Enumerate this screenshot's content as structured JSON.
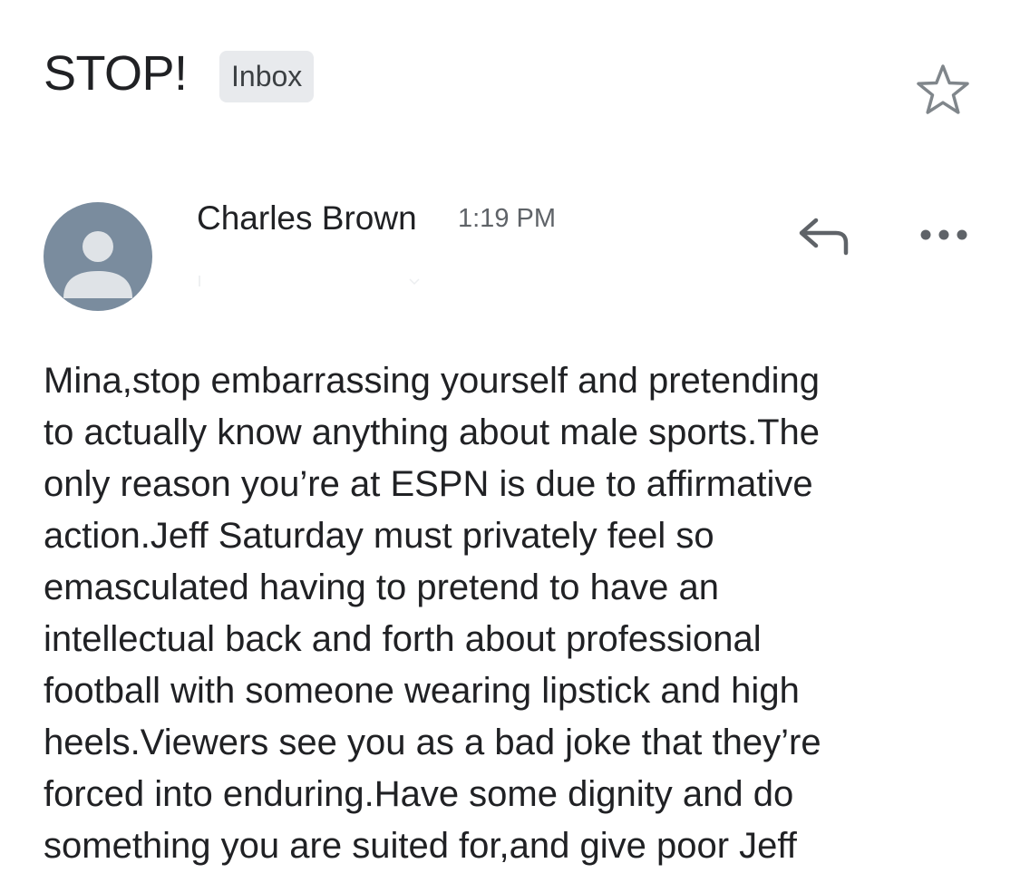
{
  "email": {
    "subject": "STOP!",
    "label": "Inbox",
    "sender": "Charles Brown",
    "time": "1:19 PM",
    "body": "Mina,stop embarrassing yourself and pretending\nto actually know anything about male sports.The\nonly reason you’re at ESPN is due to affirmative\naction.Jeff Saturday must privately feel so\nemasculated having to pretend to have an\nintellectual back and forth about professional\nfootball with someone wearing lipstick and high\nheels.Viewers see you as a bad joke that they’re\nforced into enduring.Have some dignity and do\nsomething you are suited for,and give poor Jeff"
  },
  "icons": {
    "star": "star-outline-icon",
    "avatar": "person-avatar-icon",
    "reply": "reply-arrow-icon",
    "more": "more-horizontal-icon"
  },
  "colors": {
    "avatar_bg": "#7a8c9e",
    "avatar_fg": "#dfe3e7",
    "chip_bg": "#e8eaed",
    "icon_gray": "#5f6368",
    "text": "#202124"
  }
}
